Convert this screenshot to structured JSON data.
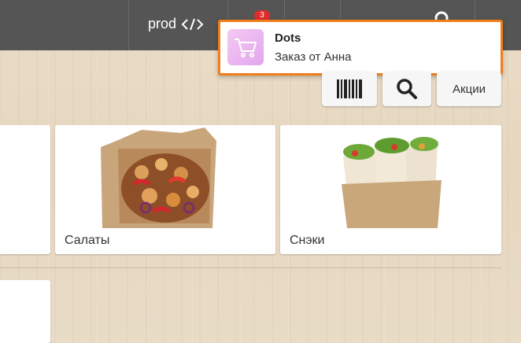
{
  "header": {
    "prod_label": "prod",
    "notification_count": "3"
  },
  "notification": {
    "title": "Dots",
    "message": "Заказ от Анна",
    "icon": "cart-icon"
  },
  "toolbar": {
    "barcode_icon": "barcode-icon",
    "search_icon": "search-icon",
    "promo_label": "Акции"
  },
  "categories": [
    {
      "label": ""
    },
    {
      "label": "Салаты"
    },
    {
      "label": "Снэки"
    }
  ]
}
